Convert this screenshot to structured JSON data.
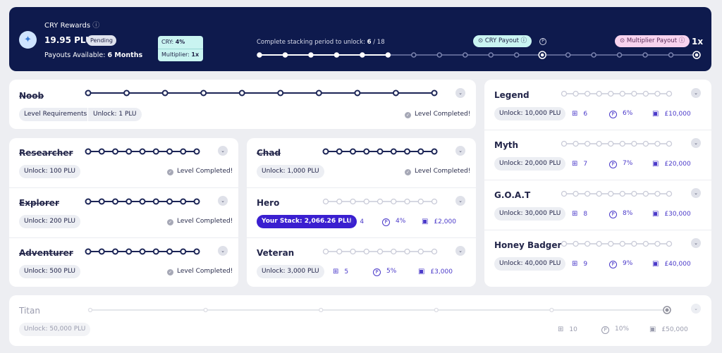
{
  "banner": {
    "title": "CRY Rewards",
    "info": "ⓘ",
    "amount": "19.95 PLU",
    "status": "Pending",
    "payouts_label": "Payouts Available:",
    "payouts_value": "6 Months",
    "cry_label": "CRY:",
    "cry_value": "4%",
    "mult_label": "Multiplier:",
    "mult_value": "1x",
    "progress_label": "Complete stacking period to unlock:",
    "progress_current": "6",
    "progress_total": "/ 18",
    "cry_payout": "CRY Payout",
    "cry_payout_icon": "ⓘ",
    "p_marker": "P",
    "mult_payout": "Multiplier Payout",
    "mult_payout_icon": "ⓘ",
    "end_label": "1x"
  },
  "shared": {
    "check": "✓",
    "chevron": "⌄",
    "completed": "Level Completed!",
    "pct_icon": "P",
    "gift_icon": "⊞",
    "cal_icon": "▣"
  },
  "levels": {
    "noob": {
      "title": "Noob",
      "req": "Level Requirements",
      "unlock": "Unlock: 1 PLU"
    },
    "researcher": {
      "title": "Researcher",
      "unlock": "Unlock: 100 PLU"
    },
    "explorer": {
      "title": "Explorer",
      "unlock": "Unlock: 200 PLU"
    },
    "adventurer": {
      "title": "Adventurer",
      "unlock": "Unlock: 500 PLU"
    },
    "chad": {
      "title": "Chad",
      "unlock": "Unlock: 1,000 PLU"
    },
    "hero": {
      "title": "Hero",
      "stack": "Your Stack: 2,066.26 PLU",
      "boxes": "4",
      "pct": "4%",
      "gbp": "£2,000"
    },
    "veteran": {
      "title": "Veteran",
      "unlock": "Unlock: 3,000 PLU",
      "boxes": "5",
      "pct": "5%",
      "gbp": "£3,000"
    },
    "legend": {
      "title": "Legend",
      "unlock": "Unlock: 10,000 PLU",
      "boxes": "6",
      "pct": "6%",
      "gbp": "£10,000"
    },
    "myth": {
      "title": "Myth",
      "unlock": "Unlock: 20,000 PLU",
      "boxes": "7",
      "pct": "7%",
      "gbp": "£20,000"
    },
    "goat": {
      "title": "G.O.A.T",
      "unlock": "Unlock: 30,000 PLU",
      "boxes": "8",
      "pct": "8%",
      "gbp": "£30,000"
    },
    "honey": {
      "title": "Honey Badger",
      "unlock": "Unlock: 40,000 PLU",
      "boxes": "9",
      "pct": "9%",
      "gbp": "£40,000"
    },
    "titan": {
      "title": "Titan",
      "unlock": "Unlock: 50,000 PLU",
      "boxes": "10",
      "pct": "10%",
      "gbp": "£50,000"
    }
  },
  "colors": {
    "navy": "#0e1a4d",
    "accent": "#4a39c9",
    "done": "#1c2556",
    "pending": "#c9cbd8",
    "mint": "#c9f4f1",
    "pink": "#f7d3ee"
  }
}
